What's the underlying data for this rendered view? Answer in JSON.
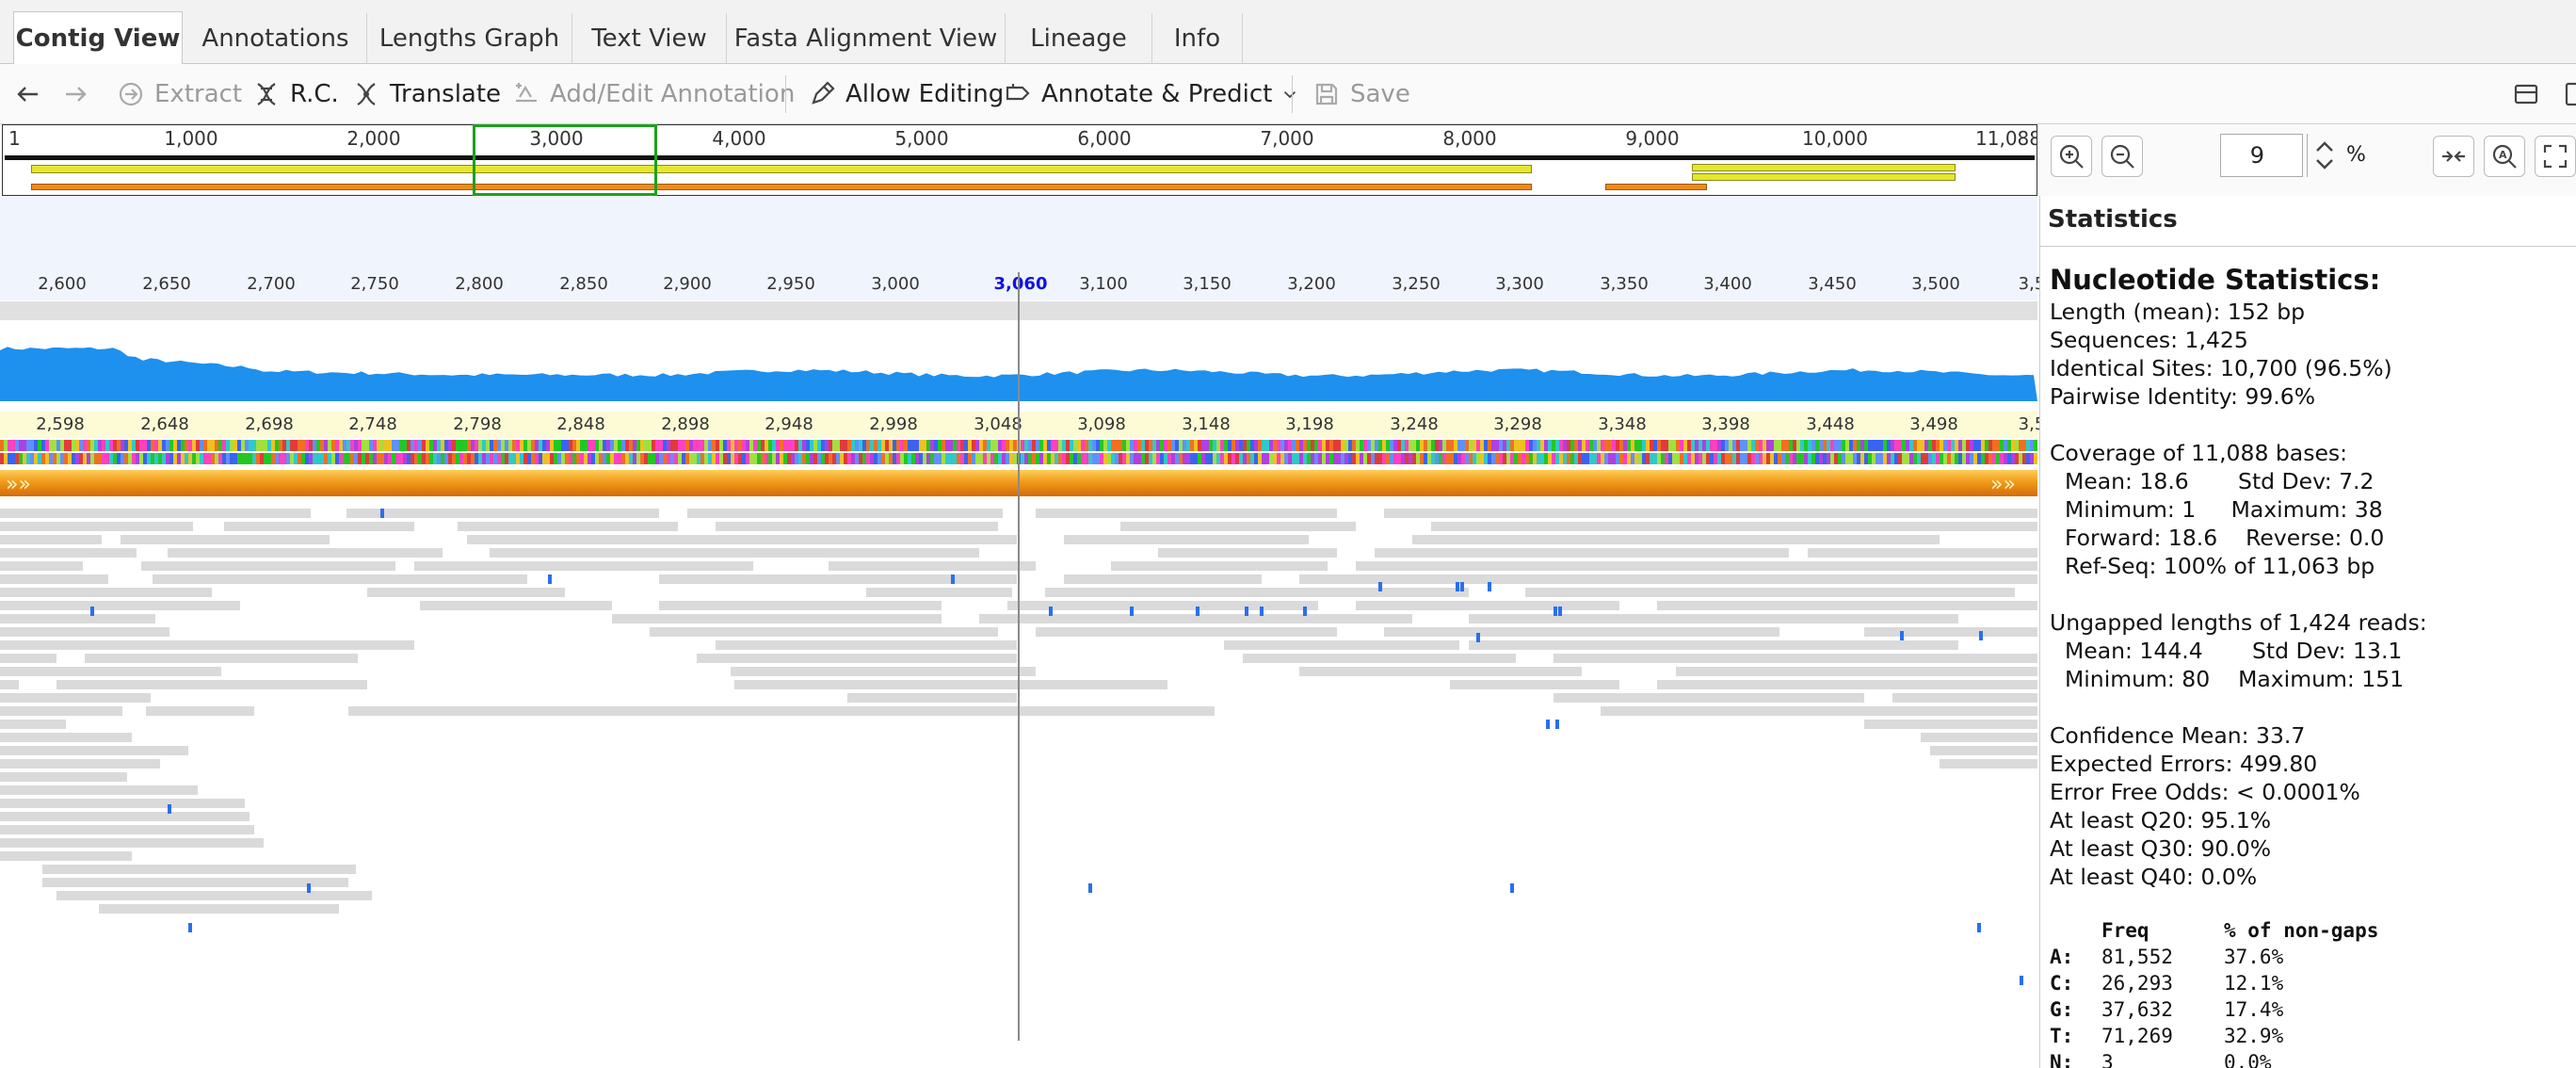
{
  "tabs": [
    "Contig View",
    "Annotations",
    "Lengths Graph",
    "Text View",
    "Fasta Alignment View",
    "Lineage",
    "Info"
  ],
  "toolbar": {
    "extract": "Extract",
    "rc": "R.C.",
    "translate": "Translate",
    "add_edit_annotation": "Add/Edit Annotation",
    "allow_editing": "Allow Editing",
    "annotate_predict": "Annotate & Predict",
    "save": "Save"
  },
  "overview": {
    "ticks": [
      "1",
      "1,000",
      "2,000",
      "3,000",
      "4,000",
      "5,000",
      "6,000",
      "7,000",
      "8,000",
      "9,000",
      "10,000",
      "11,088"
    ]
  },
  "ruler": {
    "ticks": [
      "2,600",
      "2,650",
      "2,700",
      "2,750",
      "2,800",
      "2,850",
      "2,900",
      "2,950",
      "3,000",
      "3,100",
      "3,150",
      "3,200",
      "3,250",
      "3,300",
      "3,350",
      "3,400",
      "3,450",
      "3,500",
      "3,5"
    ],
    "current": "3,060"
  },
  "ref_ruler": {
    "ticks": [
      "2,598",
      "2,648",
      "2,698",
      "2,748",
      "2,798",
      "2,848",
      "2,898",
      "2,948",
      "2,998",
      "3,048",
      "3,098",
      "3,148",
      "3,198",
      "3,248",
      "3,298",
      "3,348",
      "3,398",
      "3,448",
      "3,498",
      "3,5"
    ]
  },
  "zoom": {
    "value": "9",
    "unit": "%"
  },
  "colors": {
    "coverage": "#1e90ee",
    "annotation_yellow": "#e6e62e",
    "annotation_orange": "#ee8a1a",
    "selection": "#1ea01e",
    "read": "#dadada",
    "mismatch": "#2a6ff0",
    "current_position": "#1010e6"
  },
  "stats": {
    "title": "Statistics",
    "heading": "Nucleotide Statistics:",
    "length": "Length (mean): 152 bp",
    "sequences": "Sequences: 1,425",
    "identical": "Identical Sites: 10,700 (96.5%)",
    "pairwise": "Pairwise Identity: 99.6%",
    "coverage_head": "Coverage of 11,088 bases:",
    "cov_line1": "Mean: 18.6       Std Dev: 7.2",
    "cov_line2": "Minimum: 1     Maximum: 38",
    "cov_line3": "Forward: 18.6    Reverse: 0.0",
    "cov_line4": "Ref-Seq: 100% of 11,063 bp",
    "ungapped_head": "Ungapped lengths of 1,424 reads:",
    "ung_line1": "Mean: 144.4       Std Dev: 13.1",
    "ung_line2": "Minimum: 80    Maximum: 151",
    "confidence": "Confidence Mean: 33.7",
    "expected_errors": "Expected Errors: 499.80",
    "error_free": "Error Free Odds: < 0.0001%",
    "q20": "At least Q20: 95.1%",
    "q30": "At least Q30: 90.0%",
    "q40": "At least Q40: 0.0%",
    "freq_header": [
      "Freq",
      "% of non-gaps"
    ],
    "freq_rows": [
      {
        "base": "A:",
        "freq": "81,552",
        "pct": "37.6%"
      },
      {
        "base": "C:",
        "freq": "26,293",
        "pct": "12.1%"
      },
      {
        "base": "G:",
        "freq": "37,632",
        "pct": "17.4%"
      },
      {
        "base": "T:",
        "freq": "71,269",
        "pct": "32.9%"
      },
      {
        "base": "N:",
        "freq": "3",
        "pct": "0.0%"
      }
    ]
  }
}
